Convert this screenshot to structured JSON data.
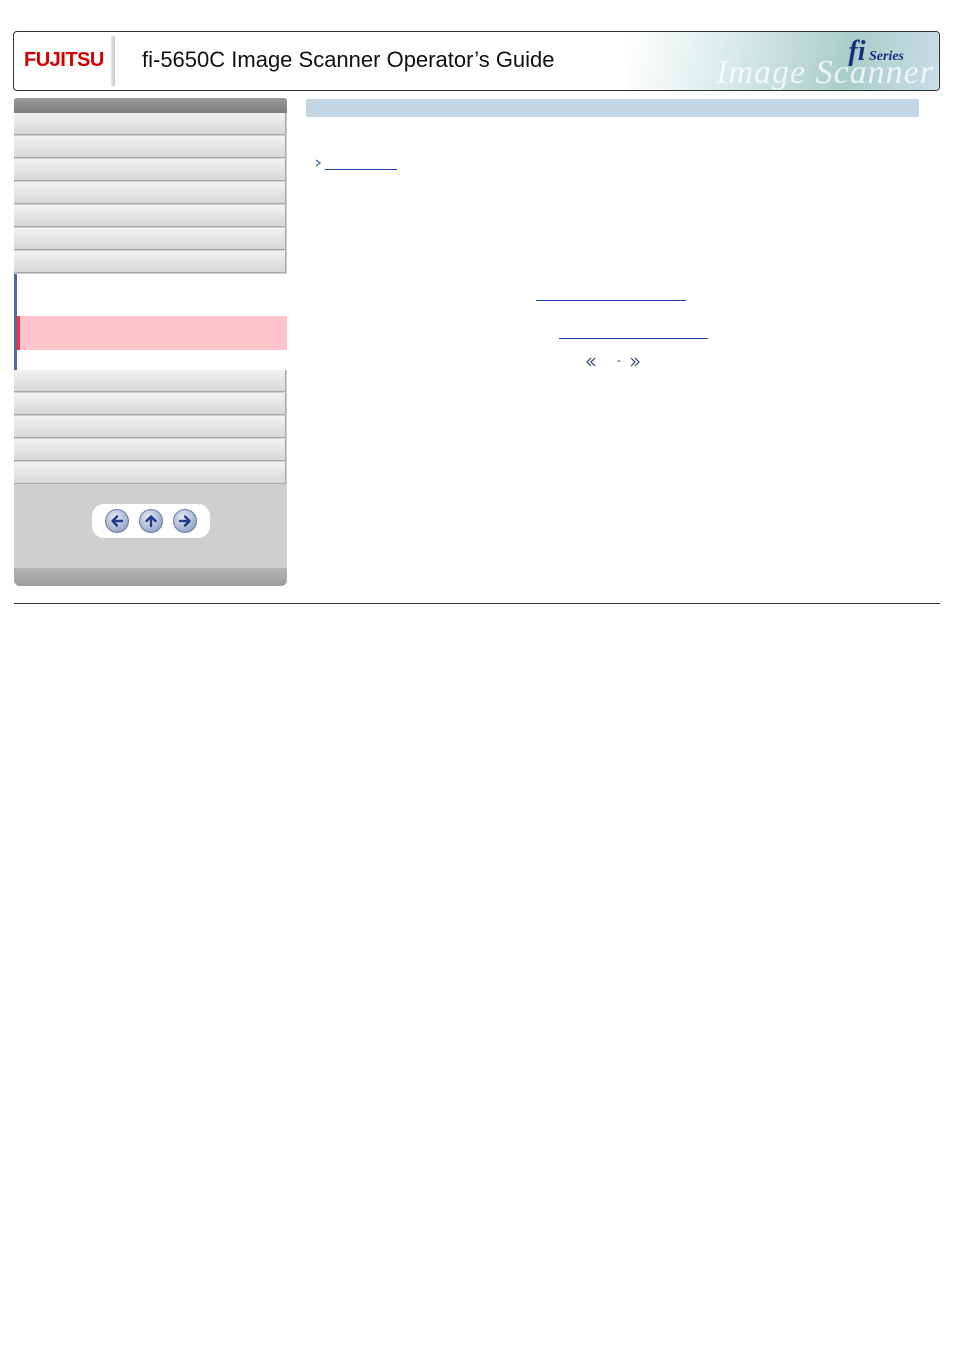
{
  "header": {
    "logo_text": "FUJITSU",
    "title": "fi-5650C Image Scanner Operator’s Guide",
    "series_logo": "fi Series",
    "banner_word": "Image Scanner"
  },
  "sidebar": {
    "nav_item_count_above": 7,
    "nav_item_count_below": 5,
    "nav_buttons": [
      "back-arrow-icon",
      "up-arrow-icon",
      "forward-arrow-icon"
    ]
  },
  "colors": {
    "active_highlight": "#fec4cd",
    "active_marker": "#ff3030",
    "content_header": "#c4d6e4",
    "link": "#1b3fa8",
    "subnav_bar": "#4e6a9f"
  },
  "content": {
    "page_range_separator": "-"
  }
}
